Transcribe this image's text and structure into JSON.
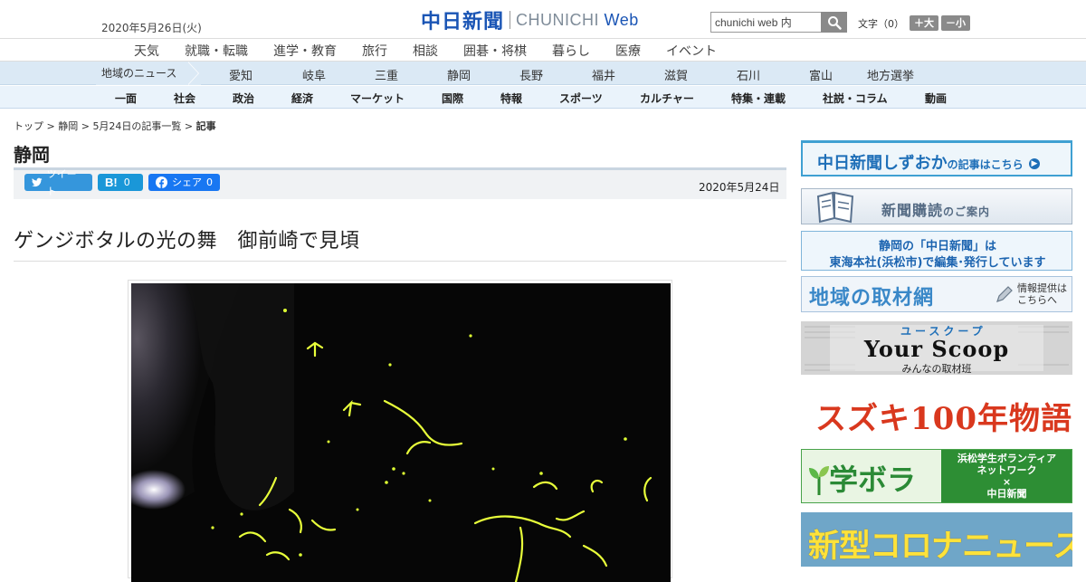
{
  "header": {
    "date": "2020年5月26日(火)",
    "logo_jp": "中日新聞",
    "logo_en": "CHUNICHI",
    "logo_web": "Web",
    "search_value": "chunichi web 内",
    "font_label": "文字（0）",
    "font_plus": "＋大",
    "font_minus": "－小"
  },
  "nav1": [
    "天気",
    "就職・転職",
    "進学・教育",
    "旅行",
    "相談",
    "囲碁・将棋",
    "暮らし",
    "医療",
    "イベント"
  ],
  "nav2": {
    "lead": "地域のニュース",
    "items": [
      "愛知",
      "岐阜",
      "三重",
      "静岡",
      "長野",
      "福井",
      "滋賀",
      "石川",
      "富山",
      "地方選挙"
    ]
  },
  "nav3": [
    "一面",
    "社会",
    "政治",
    "経済",
    "マーケット",
    "国際",
    "特報",
    "スポーツ",
    "カルチャー",
    "特集・連載",
    "社説・コラム",
    "動画"
  ],
  "breadcrumb": {
    "top": "トップ",
    "region": "静岡",
    "list": "5月24日の記事一覧",
    "current": "記事"
  },
  "section_title": "静岡",
  "share": {
    "tweet": "ツイート",
    "hatena_count": "0",
    "share_label": "シェア",
    "share_count": "0"
  },
  "article": {
    "date": "2020年5月24日",
    "headline": "ゲンジボタルの光の舞　御前崎で見頃"
  },
  "sidebar": {
    "b1_title": "中日新聞しずおか",
    "b1_sub": "の記事はこちら",
    "b2_title": "新聞購読",
    "b2_sub": "のご案内",
    "b3_line1": "静岡の「中日新聞」は",
    "b3_line2": "東海本社(浜松市)で編集･発行しています",
    "b4_title": "地域の取材網",
    "b4_sub1": "情報提供は",
    "b4_sub2": "こちらへ",
    "b5_kana": "ユースクープ",
    "b5_title": "Your Scoop",
    "b5_sub": "みんなの取材班",
    "b6_title": "スズキ100年物語",
    "b7_title": "学ボラ",
    "b7_line1": "浜松学生ボランティア",
    "b7_line2": "ネットワーク",
    "b7_cross": "×",
    "b7_line3": "中日新聞",
    "b8_title": "新型コロナニュース"
  }
}
